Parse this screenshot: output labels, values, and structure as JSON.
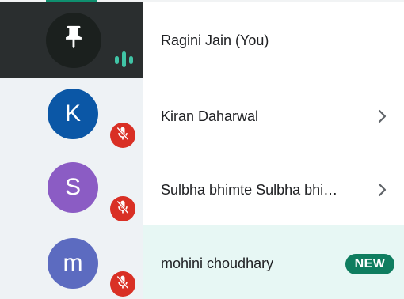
{
  "participants": [
    {
      "name": "Ragini Jain (You)",
      "avatar_initial": "",
      "avatar_color": "#1b201e",
      "tile_color": "#2a2e2f",
      "status_icon": "audio-level-icon",
      "status_color": "#40c4a6",
      "has_chevron": false,
      "badge": ""
    },
    {
      "name": "Kiran Daharwal",
      "avatar_initial": "K",
      "avatar_color": "#0b57a6",
      "tile_color": "#eef2f5",
      "status_icon": "mic-off-icon",
      "status_color": "#d93025",
      "has_chevron": true,
      "badge": ""
    },
    {
      "name": "Sulbha bhimte Sulbha bhi…",
      "avatar_initial": "S",
      "avatar_color": "#8b5cc4",
      "tile_color": "#eef2f5",
      "status_icon": "mic-off-icon",
      "status_color": "#d93025",
      "has_chevron": true,
      "badge": ""
    },
    {
      "name": "mohini choudhary",
      "avatar_initial": "m",
      "avatar_color": "#5c6bc0",
      "tile_color": "#eef2f5",
      "status_icon": "mic-off-icon",
      "status_color": "#d93025",
      "has_chevron": false,
      "badge": "NEW",
      "badge_color": "#0f7d5f",
      "highlight_color": "#e7f7f4"
    }
  ]
}
